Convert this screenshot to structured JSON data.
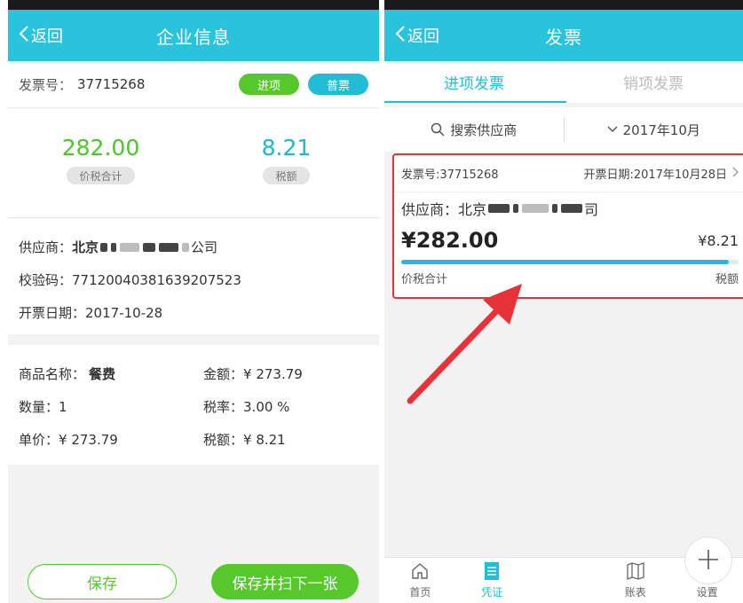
{
  "left": {
    "topbar": {
      "back_label": "返回",
      "title": "企业信息"
    },
    "invoice": {
      "label": "发票号：",
      "number": "37715268",
      "tag_in": "进项",
      "tag_normal": "普票"
    },
    "amounts": {
      "total_value": "282.00",
      "total_label": "价税合计",
      "tax_value": "8.21",
      "tax_label": "税额"
    },
    "supplier": {
      "label": "供应商：",
      "name_visible_prefix": "北京",
      "name_visible_suffix": "公司",
      "check_code_label": "校验码：",
      "check_code": "77120040381639207523",
      "date_label": "开票日期：",
      "date": "2017-10-28"
    },
    "goods": {
      "name_label": "商品名称：",
      "name": "餐费",
      "amount_label": "金额：",
      "amount": "¥ 273.79",
      "qty_label": "数量：",
      "qty": "1",
      "rate_label": "税率：",
      "rate": "3.00 %",
      "price_label": "单价：",
      "price": "¥ 273.79",
      "tax_label": "税额：",
      "tax": "¥ 8.21"
    },
    "buttons": {
      "save": "保存",
      "save_next": "保存并扫下一张"
    }
  },
  "right": {
    "topbar": {
      "back_label": "返回",
      "title": "发票"
    },
    "tabs": [
      {
        "label": "进项发票",
        "active": true
      },
      {
        "label": "销项发票",
        "active": false
      }
    ],
    "filters": {
      "search_label": "搜索供应商",
      "month_label": "2017年10月"
    },
    "card": {
      "invoice_no": "发票号:37715268",
      "issue_date": "开票日期:2017年10月28日",
      "supplier_label": "供应商：",
      "supplier_prefix": "北京",
      "supplier_suffix": "司",
      "total": "¥282.00",
      "tax": "¥8.21",
      "total_label": "价税合计",
      "tax_label": "税额",
      "progress_fraction": 0.97
    },
    "nav": [
      {
        "label": "首页",
        "icon": "home-icon",
        "active": false
      },
      {
        "label": "凭证",
        "icon": "voucher-icon",
        "active": true
      },
      {
        "label": "",
        "icon": "plus-icon",
        "active": false
      },
      {
        "label": "账表",
        "icon": "ledger-icon",
        "active": false
      },
      {
        "label": "设置",
        "icon": "settings-icon",
        "active": false
      }
    ]
  },
  "colors": {
    "header": "#29c4dc",
    "accent_blue": "#23bcd6",
    "accent_green": "#56c82c",
    "highlight_red": "#e8323a"
  }
}
